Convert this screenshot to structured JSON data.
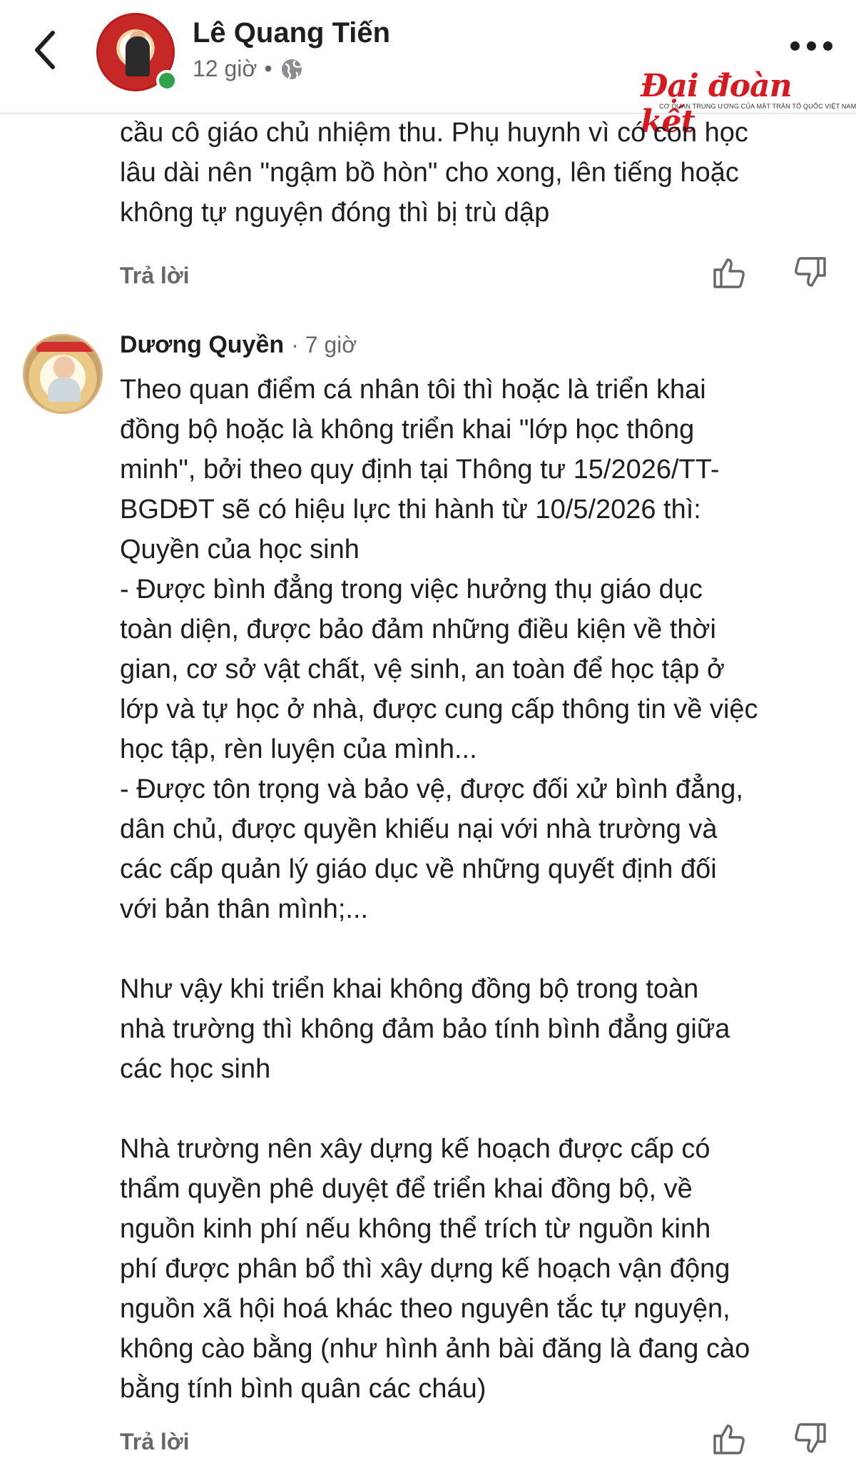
{
  "header": {
    "author_name": "Lê Quang Tiến",
    "time": "12 giờ",
    "separator": "•"
  },
  "watermark": {
    "logo_text": "Đại đoàn kết",
    "tagline": "CƠ QUAN TRUNG ƯƠNG CỦA MẶT TRẬN TỔ QUỐC VIỆT NAM"
  },
  "comment1": {
    "text": "cầu cô giáo chủ nhiệm thu. Phụ huynh vì có con học\nlâu dài nên \"ngậm bồ hòn\" cho xong, lên tiếng hoặc\nkhông tự nguyện đóng thì bị trù dập",
    "reply_label": "Trả lời"
  },
  "comment2": {
    "author": "Dương Quyền",
    "meta": "· 7 giờ",
    "text": "Theo quan điểm cá nhân tôi thì hoặc là triển khai\nđồng bộ hoặc là không triển khai \"lớp học thông\nminh\", bởi theo quy định tại Thông tư 15/2026/TT-\nBGDĐT sẽ có hiệu lực thi hành từ 10/5/2026 thì:\nQuyền của học sinh\n- Được bình đẳng trong việc hưởng thụ giáo dục\ntoàn diện, được bảo đảm những điều kiện về thời\ngian, cơ sở vật chất, vệ sinh, an toàn để học tập ở\nlớp và tự học ở nhà, được cung cấp thông tin về việc\nhọc tập, rèn luyện của mình...\n- Được tôn trọng và bảo vệ, được đối xử bình đẳng,\ndân chủ, được quyền khiếu nại với nhà trường và\ncác cấp quản lý giáo dục về những quyết định đối\nvới bản thân mình;...\n\nNhư vậy khi triển khai không đồng bộ trong toàn\nnhà trường thì không đảm bảo tính bình đẳng giữa\ncác học sinh\n\nNhà trường nên xây dựng kế hoạch được cấp có\nthẩm quyền phê duyệt để triển khai đồng bộ, về\nnguồn kinh phí nếu không thể trích từ nguồn kinh\nphí được phân bổ thì xây dựng kế hoạch vận động\nnguồn xã hội hoá khác theo nguyên tắc tự nguyện,\nkhông cào bằng (như hình ảnh bài đăng là đang cào\nbằng tính bình quân các cháu)",
    "reply_label": "Trả lời"
  },
  "icons": {
    "back": "chevron-left-icon",
    "globe": "globe-icon",
    "more": "more-horizontal-icon",
    "like": "thumbs-up-icon",
    "dislike": "thumbs-down-icon"
  },
  "colors": {
    "text_primary": "#1c1e21",
    "text_secondary": "#65676b",
    "online": "#31a24c",
    "watermark_red": "#d71920"
  }
}
